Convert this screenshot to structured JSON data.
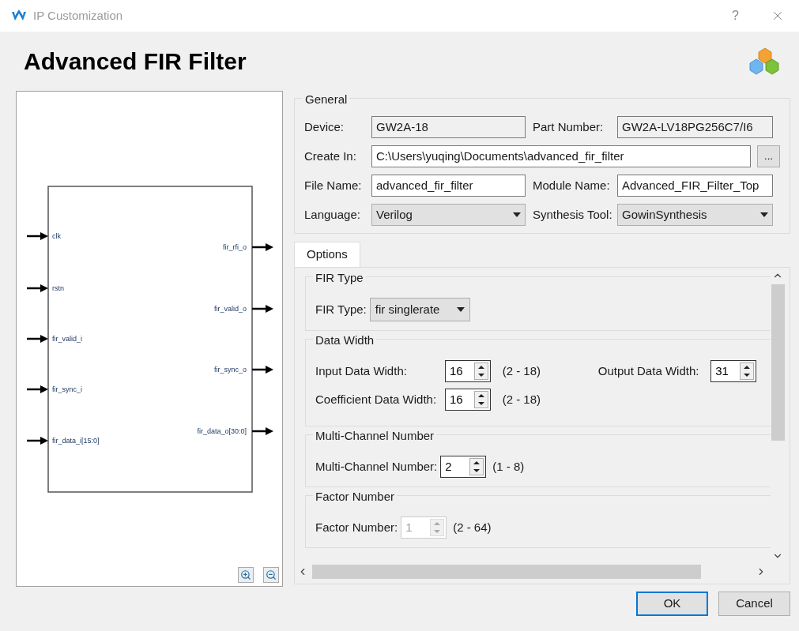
{
  "window": {
    "title": "IP Customization",
    "help": "?"
  },
  "header": {
    "title": "Advanced FIR Filter"
  },
  "diagram": {
    "inputs": [
      "clk",
      "rstn",
      "fir_valid_i",
      "fir_sync_i",
      "fir_data_i[15:0]"
    ],
    "outputs": [
      "fir_rfi_o",
      "fir_valid_o",
      "fir_sync_o",
      "fir_data_o[30:0]"
    ]
  },
  "general": {
    "title": "General",
    "rows": [
      {
        "fields": [
          {
            "label": "Device:",
            "value": "GW2A-18",
            "kind": "readonly"
          },
          {
            "label": "Part Number:",
            "value": "GW2A-LV18PG256C7/I6",
            "kind": "readonly"
          }
        ]
      },
      {
        "fields": [
          {
            "label": "Create In:",
            "value": "C:\\Users\\yuqing\\Documents\\advanced_fir_filter",
            "kind": "text"
          }
        ],
        "button": "..."
      },
      {
        "fields": [
          {
            "label": "File Name:",
            "value": "advanced_fir_filter",
            "kind": "text"
          },
          {
            "label": "Module Name:",
            "value": "Advanced_FIR_Filter_Top",
            "kind": "text"
          }
        ]
      },
      {
        "fields": [
          {
            "label": "Language:",
            "value": "Verilog",
            "kind": "select"
          },
          {
            "label": "Synthesis Tool:",
            "value": "GowinSynthesis",
            "kind": "select"
          }
        ]
      }
    ]
  },
  "tabs": [
    {
      "label": "Options",
      "selected": true
    }
  ],
  "sections": [
    {
      "title": "FIR Type",
      "kind": "rows",
      "rows": [
        [
          {
            "label": "FIR Type:",
            "value": "fir singlerate",
            "kind": "select"
          }
        ]
      ]
    },
    {
      "title": "Data Width",
      "kind": "grid",
      "rows": [
        [
          {
            "label": "Input Data Width:",
            "value": "16",
            "kind": "spin",
            "range": "(2 - 18)",
            "disabled": false
          },
          {
            "label": "Output Data Width:",
            "value": "31",
            "kind": "spin",
            "disabled": false
          }
        ],
        [
          {
            "label": "Coefficient Data Width:",
            "value": "16",
            "kind": "spin",
            "range": "(2 - 18)",
            "disabled": false
          }
        ]
      ]
    },
    {
      "title": "Multi-Channel Number",
      "kind": "rows",
      "rows": [
        [
          {
            "label": "Multi-Channel Number:",
            "value": "2",
            "kind": "spin",
            "range": "(1 - 8)",
            "disabled": false
          }
        ]
      ]
    },
    {
      "title": "Factor Number",
      "kind": "rows",
      "rows": [
        [
          {
            "label": "Factor Number:",
            "value": "1",
            "kind": "spin",
            "range": "(2 - 64)",
            "disabled": true
          }
        ]
      ]
    }
  ],
  "buttons": [
    {
      "label": "OK",
      "selected": true
    },
    {
      "label": "Cancel",
      "selected": false
    }
  ]
}
